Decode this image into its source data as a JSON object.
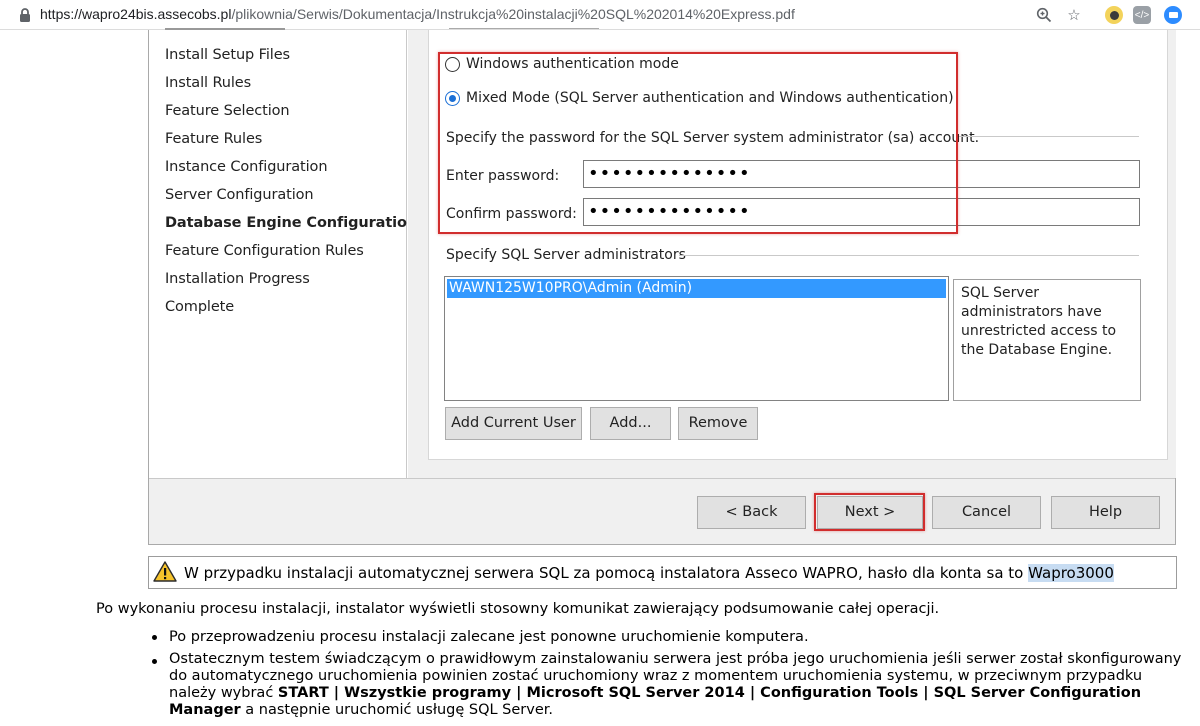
{
  "browser": {
    "url_host": "https://wapro24bis.assecobs.pl",
    "url_path": "/plikownia/Serwis/Dokumentacja/Instrukcja%20instalacji%20SQL%202014%20Express.pdf",
    "icons": [
      "lock-icon",
      "zoom-icon",
      "bookmark-star-icon",
      "extension-icons",
      "profile-avatar"
    ]
  },
  "installer": {
    "nav_items": [
      "Install Setup Files",
      "Install Rules",
      "Feature Selection",
      "Feature Rules",
      "Instance Configuration",
      "Server Configuration",
      "Database Engine Configuration",
      "Feature Configuration Rules",
      "Installation Progress",
      "Complete"
    ],
    "current_step": "Database Engine Configuration",
    "auth": {
      "windows_label": "Windows authentication mode",
      "mixed_label": "Mixed Mode (SQL Server authentication and Windows authentication)",
      "selected": "mixed",
      "sa_prompt": "Specify the password for the SQL Server system administrator (sa) account.",
      "enter_label": "Enter password:",
      "enter_value": "••••••••••••••",
      "confirm_label": "Confirm password:",
      "confirm_value": "••••••••••••••"
    },
    "admins": {
      "label": "Specify SQL Server administrators",
      "items": [
        "WAWN125W10PRO\\Admin (Admin)"
      ],
      "info": "SQL Server administrators have unrestricted access to the Database Engine.",
      "add_current_user": "Add Current User",
      "add": "Add...",
      "remove": "Remove"
    },
    "footer": {
      "back": "< Back",
      "next": "Next >",
      "cancel": "Cancel",
      "help": "Help"
    },
    "highlight_color": "#d12d2d"
  },
  "warning": {
    "text": "W przypadku instalacji automatycznej serwera SQL za pomocą instalatora Asseco WAPRO, hasło dla konta sa to ",
    "password": "Wapro3000"
  },
  "doc": {
    "para": "Po wykonaniu procesu instalacji, instalator wyświetli stosowny komunikat zawierający podsumowanie całej operacji.",
    "bullet1": "Po przeprowadzeniu procesu instalacji zalecane jest ponowne uruchomienie komputera.",
    "bullet2_line1": "Ostatecznym testem świadczącym o prawidłowym zainstalowaniu serwera jest próba jego uruchomienia jeśli serwer został skonfigurowany",
    "bullet2_line2": "do automatycznego uruchomienia powinien zostać uruchomiony wraz z momentem uruchomienia systemu, w przeciwnym przypadku",
    "bullet2_line3_pre": "należy wybrać ",
    "bullet2_line3_bold": "START | Wszystkie programy | Microsoft SQL Server 2014 | Configuration Tools | SQL Server Configuration",
    "bullet2_line4_bold": "Manager",
    "bullet2_line4_post": " a następnie uruchomić usługę SQL Server."
  }
}
